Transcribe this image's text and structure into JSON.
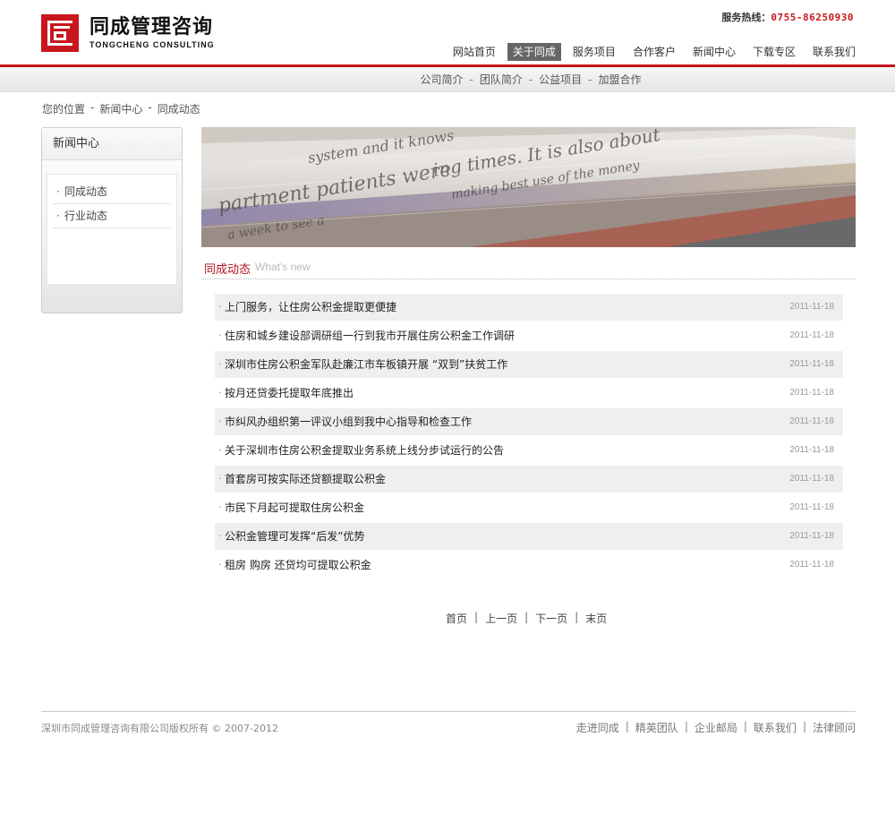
{
  "header": {
    "logo_cn": "同成管理咨询",
    "logo_en": "TONGCHENG CONSULTING",
    "hotline_label": "服务热线：",
    "hotline_number": "0755-86250930",
    "nav": [
      {
        "label": "网站首页",
        "active": false
      },
      {
        "label": "关于同成",
        "active": true
      },
      {
        "label": "服务项目",
        "active": false
      },
      {
        "label": "合作客户",
        "active": false
      },
      {
        "label": "新闻中心",
        "active": false
      },
      {
        "label": "下载专区",
        "active": false
      },
      {
        "label": "联系我们",
        "active": false
      }
    ]
  },
  "subnav": {
    "items": [
      "公司简介",
      "团队简介",
      "公益项目",
      "加盟合作"
    ],
    "separator": "-"
  },
  "breadcrumb": {
    "items": [
      "您的位置",
      "新闻中心",
      "同成动态"
    ],
    "separator": "-"
  },
  "sidebar": {
    "title": "新闻中心",
    "items": [
      "同成动态",
      "行业动态"
    ]
  },
  "section": {
    "title_cn": "同成动态",
    "title_en": "What's new"
  },
  "news": [
    {
      "title": "上门服务，让住房公积金提取更便捷",
      "date": "2011-11-18"
    },
    {
      "title": "住房和城乡建设部调研组一行到我市开展住房公积金工作调研",
      "date": "2011-11-18"
    },
    {
      "title": "深圳市住房公积金军队赴廉江市车板镇开展 “双到”扶贫工作",
      "date": "2011-11-18"
    },
    {
      "title": "按月还贷委托提取年底推出",
      "date": "2011-11-18"
    },
    {
      "title": "市纠风办组织第一评议小组到我中心指导和检查工作",
      "date": "2011-11-18"
    },
    {
      "title": "关于深圳市住房公积金提取业务系统上线分步试运行的公告",
      "date": "2011-11-18"
    },
    {
      "title": "首套房可按实际还贷额提取公积金",
      "date": "2011-11-18"
    },
    {
      "title": "市民下月起可提取住房公积金",
      "date": "2011-11-18"
    },
    {
      "title": "公积金管理可发挥“后发”优势",
      "date": "2011-11-18"
    },
    {
      "title": "租房 购房 还贷均可提取公积金",
      "date": "2011-11-18"
    }
  ],
  "pager": {
    "items": [
      "首页",
      "上一页",
      "下一页",
      "末页"
    ],
    "separator": "|"
  },
  "footer": {
    "copyright": "深圳市同成管理咨询有限公司版权所有 © 2007-2012",
    "links": [
      "走进同成",
      "精英团队",
      "企业邮局",
      "联系我们",
      "法律顾问"
    ],
    "separator": "|"
  },
  "colors": {
    "brand_red": "#c8161d",
    "active_nav_bg": "#666666",
    "bullet_orange": "#e07a00"
  }
}
